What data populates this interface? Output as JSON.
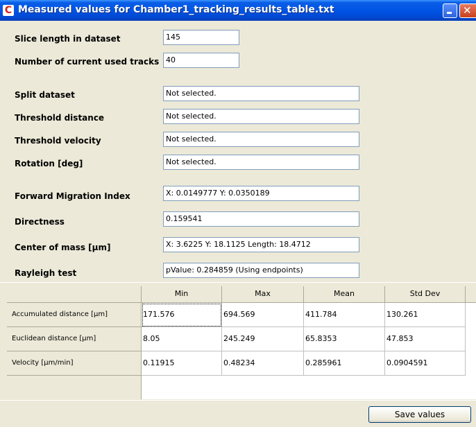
{
  "window": {
    "title": "Measured values for Chamber1_tracking_results_table.txt",
    "app_icon_glyph": "C"
  },
  "fields": [
    {
      "label": "Slice length in dataset",
      "value": "145"
    },
    {
      "label": "Number of current used tracks",
      "value": "40"
    },
    {
      "label": "Split dataset",
      "value": "Not selected."
    },
    {
      "label": "Threshold distance",
      "value": "Not selected."
    },
    {
      "label": "Threshold velocity",
      "value": "Not selected."
    },
    {
      "label": "Rotation [deg]",
      "value": "Not selected."
    },
    {
      "label": "Forward Migration Index",
      "value": "X: 0.0149777  Y: 0.0350189"
    },
    {
      "label": "Directness",
      "value": "0.159541"
    },
    {
      "label": "Center of mass  [µm]",
      "value": "X: 3.6225  Y: 18.1125  Length: 18.4712"
    },
    {
      "label": "Rayleigh test",
      "value": "pValue: 0.284859 (Using endpoints)"
    }
  ],
  "table": {
    "columns": [
      "Min",
      "Max",
      "Mean",
      "Std Dev"
    ],
    "rows": [
      {
        "label": "Accumulated distance [µm]",
        "values": [
          "171.576",
          "694.569",
          "411.784",
          "130.261"
        ]
      },
      {
        "label": "Euclidean distance [µm]",
        "values": [
          "8.05",
          "245.249",
          "65.8353",
          "47.853"
        ]
      },
      {
        "label": "Velocity [µm/min]",
        "values": [
          "0.11915",
          "0.48234",
          "0.285961",
          "0.0904591"
        ]
      }
    ]
  },
  "buttons": {
    "save": "Save values"
  },
  "colors": {
    "titlebar": "#0055e5",
    "window_bg": "#ece9d8",
    "field_border": "#7f9db9"
  }
}
